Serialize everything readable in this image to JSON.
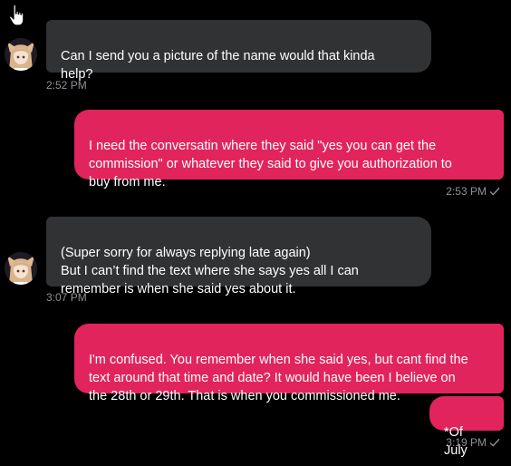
{
  "colors": {
    "background": "#000000",
    "incoming_bubble": "#313234",
    "outgoing_bubble": "#e2245c",
    "timestamp": "#8d9196"
  },
  "cursor": {
    "icon": "hand-pointer-icon"
  },
  "messages": [
    {
      "direction": "incoming",
      "text": "Can I send you a picture of the name would that kinda\nhelp?",
      "time": "2:52 PM"
    },
    {
      "direction": "outgoing",
      "text": "I  need the conversatin where they said \"yes you can get the\ncommission\" or whatever they said to give you authorization to\nbuy from me.",
      "time": "2:53 PM",
      "status_icon": "sent-check-icon"
    },
    {
      "direction": "incoming",
      "text": "(Super sorry for always replying late again)\nBut I can’t find the text where she says yes all I can\nremember is when she said yes about it.",
      "time": "3:07 PM"
    },
    {
      "direction": "outgoing",
      "text": "I'm confused. You remember when she said yes, but cant find the\ntext around that time and date?  It would have been I believe on\nthe 28th or 29th.  That is when you commissioned me.",
      "time": null
    },
    {
      "direction": "outgoing",
      "text": "*Of July",
      "time": "3:19 PM",
      "status_icon": "sent-check-icon"
    }
  ]
}
